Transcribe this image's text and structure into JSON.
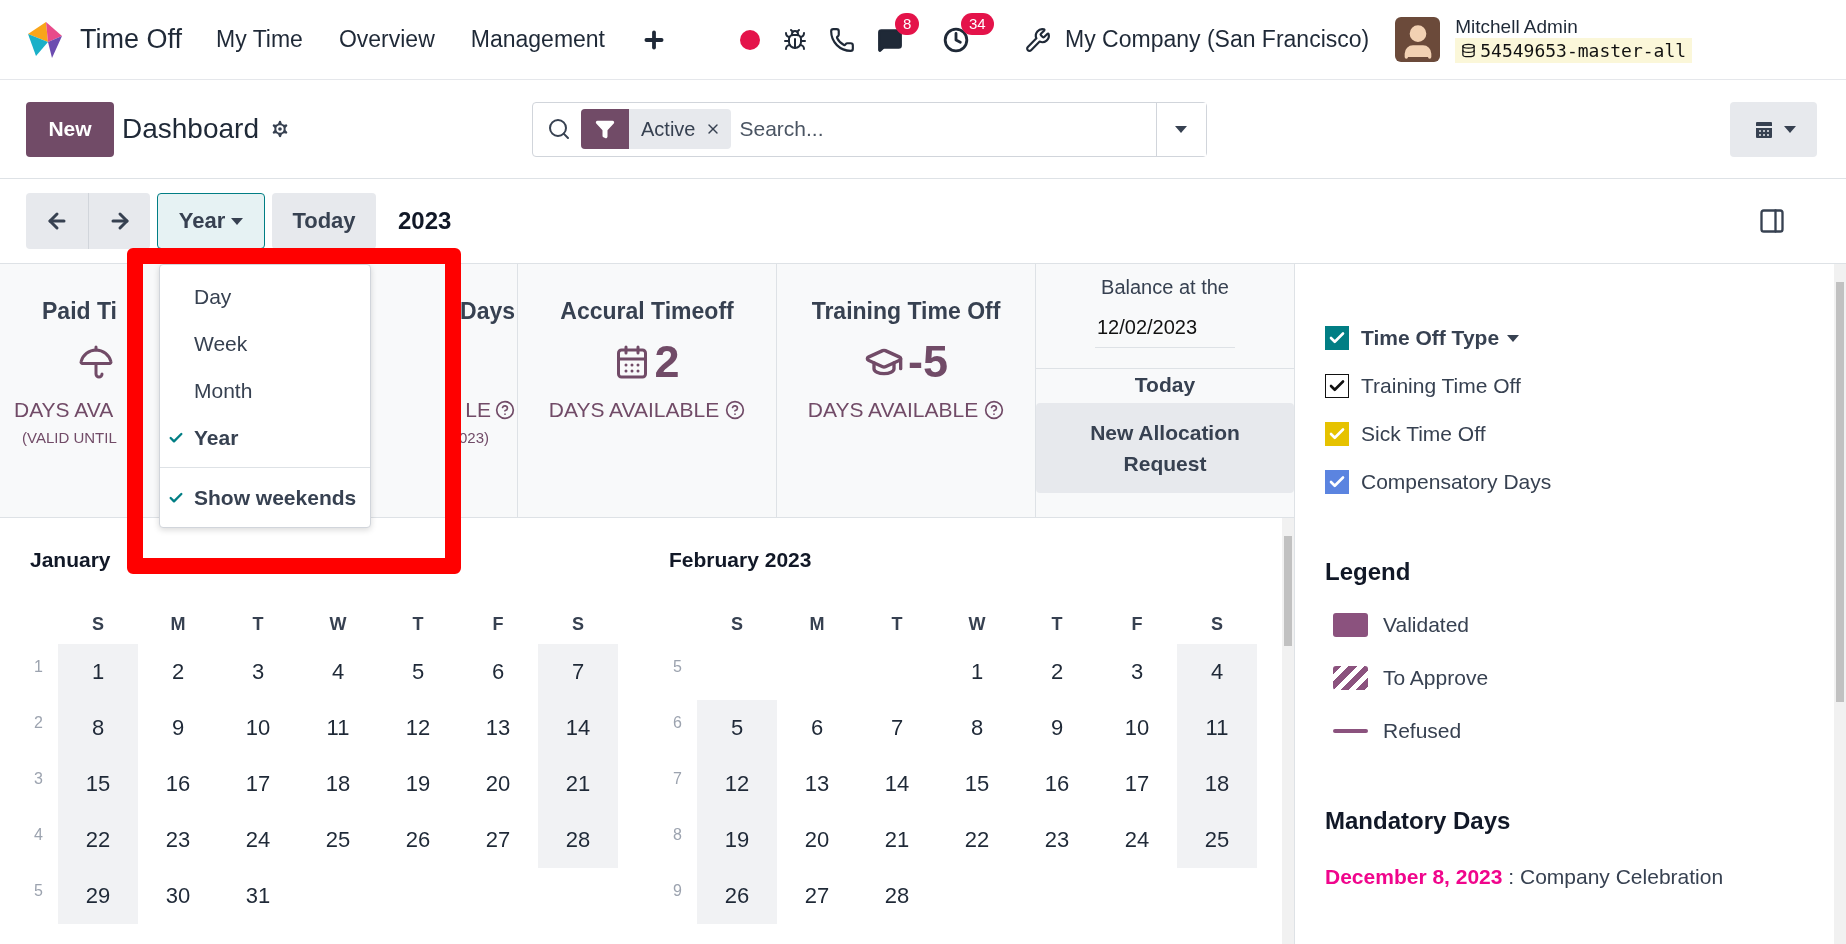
{
  "navbar": {
    "app_name": "Time Off",
    "menu": [
      "My Time",
      "Overview",
      "Management"
    ],
    "messages_badge": "8",
    "activities_badge": "34",
    "company": "My Company (San Francisco)",
    "user": "Mitchell Admin",
    "database": "54549653-master-all"
  },
  "control_panel": {
    "new_button": "New",
    "title": "Dashboard",
    "facet": "Active",
    "search_placeholder": "Search..."
  },
  "toolbar": {
    "scale": "Year",
    "today": "Today",
    "period": "2023"
  },
  "dropdown": {
    "items": [
      {
        "label": "Day",
        "selected": false
      },
      {
        "label": "Week",
        "selected": false
      },
      {
        "label": "Month",
        "selected": false
      },
      {
        "label": "Year",
        "selected": true
      }
    ],
    "show_weekends": {
      "label": "Show weekends",
      "checked": true
    }
  },
  "cards": [
    {
      "kind": "leftcut",
      "title": "Paid Ti",
      "subtitle": "DAYS AVA",
      "note": "(VALID UNTIL"
    },
    {
      "kind": "rightcut",
      "title": "Days",
      "subtitle": "LE",
      "note": "023)"
    },
    {
      "kind": "calendar",
      "title": "Accural Timeoff",
      "value": "2",
      "subtitle": "DAYS AVAILABLE"
    },
    {
      "kind": "graduation",
      "title": "Training Time Off",
      "value": "-5",
      "subtitle": "DAYS AVAILABLE"
    }
  ],
  "balance": {
    "label": "Balance at the",
    "date": "12/02/2023",
    "today": "Today",
    "button": "New Allocation Request"
  },
  "months": [
    {
      "title": "January",
      "weekdays": [
        "S",
        "M",
        "T",
        "W",
        "T",
        "F",
        "S"
      ],
      "weeks": [
        {
          "number": "1",
          "days": [
            "1",
            "2",
            "3",
            "4",
            "5",
            "6",
            "7"
          ]
        },
        {
          "number": "2",
          "days": [
            "8",
            "9",
            "10",
            "11",
            "12",
            "13",
            "14"
          ]
        },
        {
          "number": "3",
          "days": [
            "15",
            "16",
            "17",
            "18",
            "19",
            "20",
            "21"
          ]
        },
        {
          "number": "4",
          "days": [
            "22",
            "23",
            "24",
            "25",
            "26",
            "27",
            "28"
          ]
        },
        {
          "number": "5",
          "kind": "ends_early",
          "days": [
            "29",
            "30",
            "31"
          ]
        }
      ]
    },
    {
      "title": "February 2023",
      "weekdays": [
        "S",
        "M",
        "T",
        "W",
        "T",
        "F",
        "S"
      ],
      "weeks": [
        {
          "number": "5",
          "kind": "starts_late",
          "days": [
            "1",
            "2",
            "3",
            "4"
          ]
        },
        {
          "number": "6",
          "days": [
            "5",
            "6",
            "7",
            "8",
            "9",
            "10",
            "11"
          ]
        },
        {
          "number": "7",
          "days": [
            "12",
            "13",
            "14",
            "15",
            "16",
            "17",
            "18"
          ]
        },
        {
          "number": "8",
          "days": [
            "19",
            "20",
            "21",
            "22",
            "23",
            "24",
            "25"
          ]
        },
        {
          "number": "9",
          "kind": "ends_early",
          "days": [
            "26",
            "27",
            "28"
          ]
        }
      ]
    }
  ],
  "filters": {
    "title": "Time Off Type",
    "checked": true,
    "color": "#017e84",
    "items": [
      {
        "label": "Training Time Off",
        "checked": true,
        "color": "#ffffff"
      },
      {
        "label": "Sick Time Off",
        "checked": true,
        "color": "#e6c200"
      },
      {
        "label": "Compensatory Days",
        "checked": true,
        "color": "#5b84e0"
      }
    ]
  },
  "legend": {
    "title": "Legend",
    "items": [
      {
        "kind": "solid",
        "label": "Validated"
      },
      {
        "kind": "striped",
        "label": "To Approve"
      },
      {
        "kind": "line",
        "label": "Refused"
      }
    ]
  },
  "mandatory_days": {
    "title": "Mandatory Days",
    "items": [
      {
        "date": "December 8, 2023",
        "text": ": Company Celebration",
        "color": "#f0058c"
      }
    ]
  }
}
